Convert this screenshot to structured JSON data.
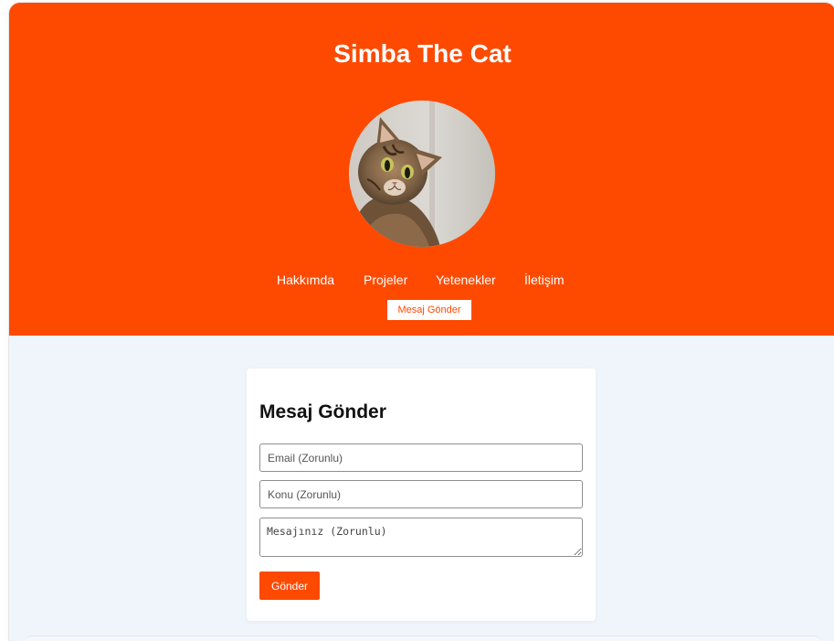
{
  "header": {
    "title": "Simba The Cat",
    "avatar_icon": "cat-photo",
    "bg_color": "#fe4a01"
  },
  "nav": {
    "links": [
      "Hakkımda",
      "Projeler",
      "Yetenekler",
      "İletişim"
    ],
    "button_label": "Mesaj Gönder"
  },
  "form": {
    "title": "Mesaj Gönder",
    "email_placeholder": "Email (Zorunlu)",
    "subject_placeholder": "Konu (Zorunlu)",
    "message_placeholder": "Mesajınız (Zorunlu)",
    "submit_label": "Gönder"
  },
  "colors": {
    "accent": "#fe4a01",
    "page_bg": "#f0f5fc",
    "card_bg": "#ffffff"
  }
}
